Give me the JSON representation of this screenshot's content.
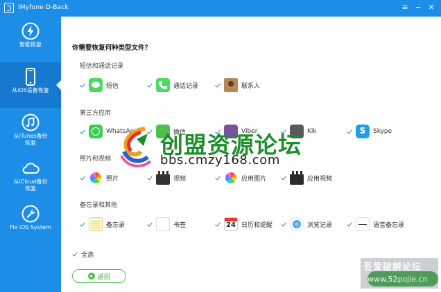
{
  "window": {
    "title": "iMyfone D-Back",
    "controls": {
      "menu": "≡",
      "minimize": "−",
      "close": "✕"
    }
  },
  "sidebar": {
    "items": [
      {
        "label": "智能恢复",
        "icon": "lightning-icon"
      },
      {
        "label": "从iOS设备恢复",
        "icon": "iphone-icon",
        "active": true
      },
      {
        "label": "从iTunes备份\n恢复",
        "icon": "music-note-icon"
      },
      {
        "label": "从iCloud备份\n恢复",
        "icon": "cloud-icon"
      },
      {
        "label": "Fix iOS System",
        "icon": "wrench-icon"
      }
    ]
  },
  "main": {
    "question": "你需要恢复何种类型文件？",
    "sections": [
      {
        "title": "短信和通话记录",
        "items": [
          "短信",
          "通话记录",
          "联系人"
        ]
      },
      {
        "title": "第三方应用",
        "items": [
          "WhatsApp",
          "微信",
          "Viber",
          "Kik",
          "Skype"
        ]
      },
      {
        "title": "照片和视频",
        "items": [
          "照片",
          "视频",
          "应用图片",
          "应用视频"
        ]
      },
      {
        "title": "备忘录和其他",
        "items": [
          "备忘录",
          "书签",
          "日历和提醒",
          "浏览记录",
          "语音备忘录"
        ]
      }
    ],
    "calendar_day": "24",
    "select_all": "全选",
    "back_button": "返回"
  },
  "watermark": {
    "title": "创盟资源论坛",
    "url": "bbs.cmzy168.com",
    "secondary_title": "吾爱破解论坛",
    "secondary_url": "www.52pojie.cn"
  },
  "colors": {
    "primary_blue": "#1d8ee8",
    "active_blue": "#1579cf",
    "accent_green": "#3cb043",
    "check_blue": "#2a7fd6"
  }
}
